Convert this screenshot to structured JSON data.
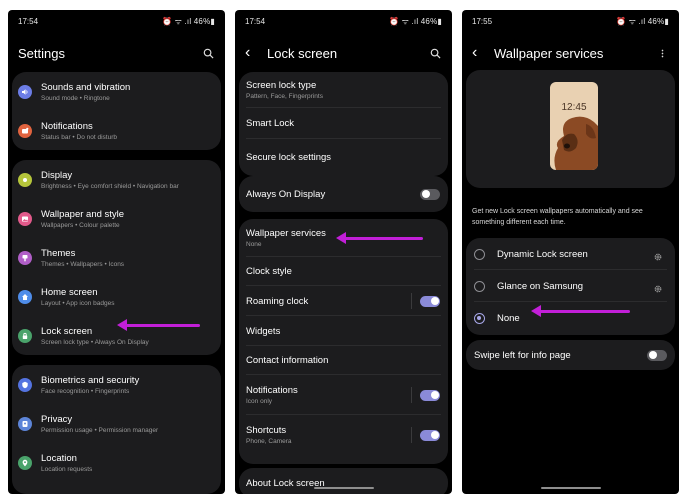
{
  "screens": [
    {
      "status_time": "17:54",
      "status_right": "46%",
      "title": "Settings",
      "groups": [
        {
          "items": [
            {
              "title": "Sounds and vibration",
              "subtitle": "Sound mode • Ringtone",
              "icon": "volume-icon",
              "color": "#6c7de6"
            },
            {
              "title": "Notifications",
              "subtitle": "Status bar • Do not disturb",
              "icon": "bell-icon",
              "color": "#e0633f"
            }
          ]
        },
        {
          "items": [
            {
              "title": "Display",
              "subtitle": "Brightness • Eye comfort shield • Navigation bar",
              "icon": "sun-icon",
              "color": "#b5c53b"
            },
            {
              "title": "Wallpaper and style",
              "subtitle": "Wallpapers • Colour palette",
              "icon": "image-icon",
              "color": "#e25a8b"
            },
            {
              "title": "Themes",
              "subtitle": "Themes • Wallpapers • Icons",
              "icon": "brush-icon",
              "color": "#b05ec7"
            },
            {
              "title": "Home screen",
              "subtitle": "Layout • App icon badges",
              "icon": "home-icon",
              "color": "#4f8dea"
            },
            {
              "title": "Lock screen",
              "subtitle": "Screen lock type • Always On Display",
              "icon": "lock-icon",
              "color": "#4aa36b"
            }
          ]
        },
        {
          "items": [
            {
              "title": "Biometrics and security",
              "subtitle": "Face recognition • Fingerprints",
              "icon": "shield-icon",
              "color": "#5473e0"
            },
            {
              "title": "Privacy",
              "subtitle": "Permission usage • Permission manager",
              "icon": "privacy-icon",
              "color": "#5d85d8"
            },
            {
              "title": "Location",
              "subtitle": "Location requests",
              "icon": "location-icon",
              "color": "#4aa36b"
            }
          ]
        }
      ]
    },
    {
      "status_time": "17:54",
      "status_right": "46%",
      "title": "Lock screen",
      "groups": [
        {
          "items": [
            {
              "title": "Screen lock type",
              "subtitle": "Pattern, Face, Fingerprints"
            },
            {
              "title": "Smart Lock",
              "subtitle": ""
            },
            {
              "title": "Secure lock settings",
              "subtitle": ""
            }
          ]
        },
        {
          "items": [
            {
              "title": "Always On Display",
              "subtitle": "",
              "toggle": "off"
            }
          ]
        },
        {
          "items": [
            {
              "title": "Wallpaper services",
              "subtitle": "None"
            },
            {
              "title": "Clock style",
              "subtitle": ""
            },
            {
              "title": "Roaming clock",
              "subtitle": "",
              "toggle": "on"
            },
            {
              "title": "Widgets",
              "subtitle": ""
            },
            {
              "title": "Contact information",
              "subtitle": ""
            },
            {
              "title": "Notifications",
              "subtitle": "Icon only",
              "toggle": "on"
            },
            {
              "title": "Shortcuts",
              "subtitle": "Phone, Camera",
              "toggle": "on"
            }
          ]
        },
        {
          "items": [
            {
              "title": "About Lock screen",
              "subtitle": ""
            }
          ]
        }
      ]
    },
    {
      "status_time": "17:55",
      "status_right": "46%",
      "title": "Wallpaper services",
      "preview_clock": "12:45",
      "description": "Get new Lock screen wallpapers automatically and see something different each time.",
      "options": [
        {
          "label": "Dynamic Lock screen",
          "selected": false,
          "has_settings": true
        },
        {
          "label": "Glance on Samsung",
          "selected": false,
          "has_settings": true
        },
        {
          "label": "None",
          "selected": true,
          "has_settings": false
        }
      ],
      "swipe_option": {
        "label": "Swipe left for info page",
        "toggle": "off"
      }
    }
  ],
  "colors": {
    "background": "#000000",
    "card": "#1c1c1e",
    "toggle_on": "#8a8ad8",
    "toggle_off": "#5a5a5e",
    "annotation_arrow": "#c21fd8"
  }
}
